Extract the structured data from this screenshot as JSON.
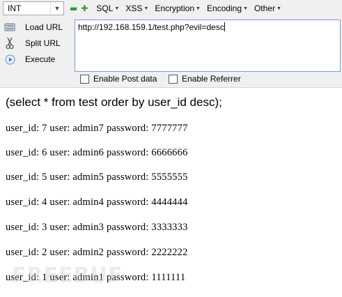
{
  "hackbar": {
    "type_select": "INT",
    "minus": "▬",
    "plus": "✚",
    "menus": [
      {
        "label": "SQL"
      },
      {
        "label": "XSS"
      },
      {
        "label": "Encryption"
      },
      {
        "label": "Encoding"
      },
      {
        "label": "Other"
      }
    ],
    "buttons": {
      "load_label": "Load URL",
      "split_label": "Split URL",
      "execute_label": "Execute"
    },
    "url_value": "http://192.168.159.1/test.php?evil=desc",
    "enable_post_label": "Enable Post data",
    "enable_referrer_label": "Enable Referrer",
    "accent_color": "#2e9a2e"
  },
  "output": {
    "query": "(select * from test order by user_id desc);",
    "rows": [
      "user_id: 7 user: admin7 password: 7777777",
      "user_id: 6 user: admin6 password: 6666666",
      "user_id: 5 user: admin5 password: 5555555",
      "user_id: 4 user: admin4 password: 4444444",
      "user_id: 3 user: admin3 password: 3333333",
      "user_id: 2 user: admin2 password: 2222222",
      "user_id: 1 user: admin1 password: 1111111"
    ]
  },
  "watermark": {
    "text": "FREEBUF"
  }
}
